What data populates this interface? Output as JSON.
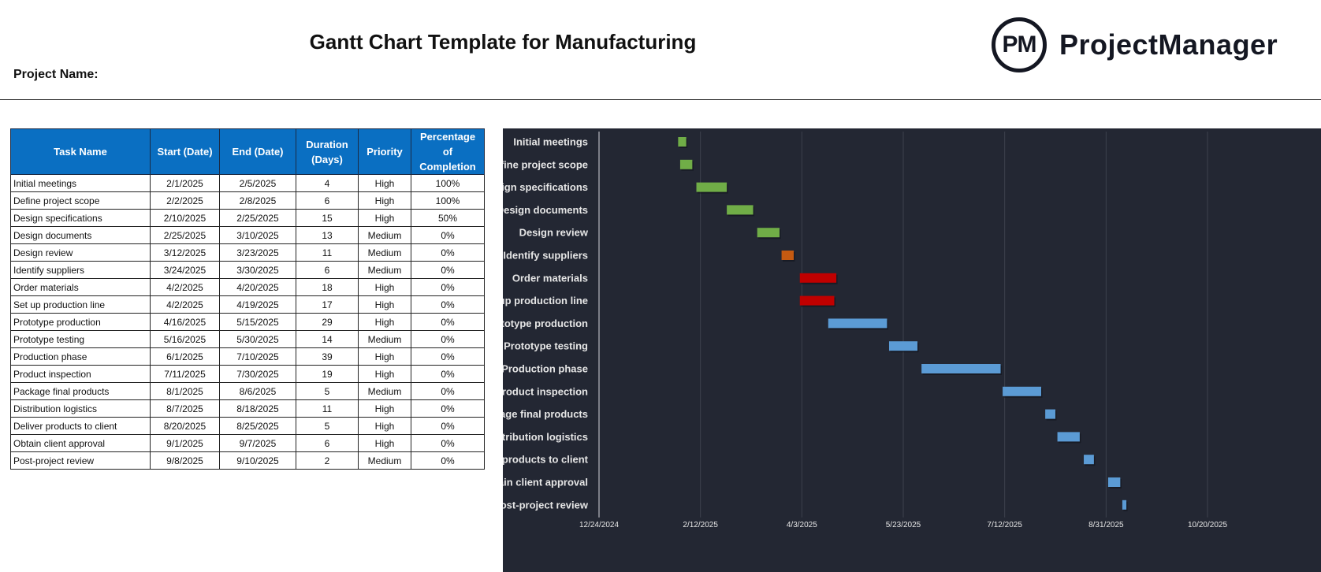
{
  "header": {
    "title": "Gantt Chart Template for Manufacturing",
    "project_name_label": "Project Name:",
    "logo": {
      "mark": "PM",
      "brand": "ProjectManager"
    }
  },
  "table": {
    "columns": [
      "Task Name",
      "Start  (Date)",
      "End  (Date)",
      "Duration (Days)",
      "Priority",
      "Percentage of Completion"
    ],
    "rows": [
      [
        "Initial meetings",
        "2/1/2025",
        "2/5/2025",
        "4",
        "High",
        "100%"
      ],
      [
        "Define project scope",
        "2/2/2025",
        "2/8/2025",
        "6",
        "High",
        "100%"
      ],
      [
        "Design specifications",
        "2/10/2025",
        "2/25/2025",
        "15",
        "High",
        "50%"
      ],
      [
        "Design documents",
        "2/25/2025",
        "3/10/2025",
        "13",
        "Medium",
        "0%"
      ],
      [
        "Design review",
        "3/12/2025",
        "3/23/2025",
        "11",
        "Medium",
        "0%"
      ],
      [
        "Identify suppliers",
        "3/24/2025",
        "3/30/2025",
        "6",
        "Medium",
        "0%"
      ],
      [
        "Order materials",
        "4/2/2025",
        "4/20/2025",
        "18",
        "High",
        "0%"
      ],
      [
        "Set up production line",
        "4/2/2025",
        "4/19/2025",
        "17",
        "High",
        "0%"
      ],
      [
        "Prototype production",
        "4/16/2025",
        "5/15/2025",
        "29",
        "High",
        "0%"
      ],
      [
        "Prototype testing",
        "5/16/2025",
        "5/30/2025",
        "14",
        "Medium",
        "0%"
      ],
      [
        "Production phase",
        "6/1/2025",
        "7/10/2025",
        "39",
        "High",
        "0%"
      ],
      [
        "Product inspection",
        "7/11/2025",
        "7/30/2025",
        "19",
        "High",
        "0%"
      ],
      [
        "Package final products",
        "8/1/2025",
        "8/6/2025",
        "5",
        "Medium",
        "0%"
      ],
      [
        "Distribution logistics",
        "8/7/2025",
        "8/18/2025",
        "11",
        "High",
        "0%"
      ],
      [
        "Deliver products to client",
        "8/20/2025",
        "8/25/2025",
        "5",
        "High",
        "0%"
      ],
      [
        "Obtain client approval",
        "9/1/2025",
        "9/7/2025",
        "6",
        "High",
        "0%"
      ],
      [
        "Post-project review",
        "9/8/2025",
        "9/10/2025",
        "2",
        "Medium",
        "0%"
      ]
    ]
  },
  "chart_data": {
    "type": "bar",
    "orientation": "horizontal-gantt",
    "title": "",
    "xlabel": "",
    "ylabel": "",
    "x_axis": {
      "type": "date",
      "range": [
        "2024-12-24",
        "2025-10-20"
      ],
      "tick_labels": [
        "12/24/2024",
        "2/12/2025",
        "4/3/2025",
        "5/23/2025",
        "7/12/2025",
        "8/31/2025",
        "10/20/2025"
      ],
      "tick_interval_days": 50,
      "grid": true
    },
    "legend": "none",
    "colors": {
      "green": "#70ad47",
      "orange": "#c55a11",
      "red": "#c00000",
      "blue": "#5b9bd5",
      "background": "#232733"
    },
    "tasks": [
      {
        "name": "Initial meetings",
        "start": "2025-02-01",
        "duration": 4,
        "color": "green"
      },
      {
        "name": "Define project scope",
        "start": "2025-02-02",
        "duration": 6,
        "color": "green"
      },
      {
        "name": "Design specifications",
        "start": "2025-02-10",
        "duration": 15,
        "color": "green"
      },
      {
        "name": "Design documents",
        "start": "2025-02-25",
        "duration": 13,
        "color": "green"
      },
      {
        "name": "Design review",
        "start": "2025-03-12",
        "duration": 11,
        "color": "green"
      },
      {
        "name": "Identify suppliers",
        "start": "2025-03-24",
        "duration": 6,
        "color": "orange"
      },
      {
        "name": "Order materials",
        "start": "2025-04-02",
        "duration": 18,
        "color": "red"
      },
      {
        "name": "Set up production line",
        "start": "2025-04-02",
        "duration": 17,
        "color": "red"
      },
      {
        "name": "Prototype production",
        "start": "2025-04-16",
        "duration": 29,
        "color": "blue"
      },
      {
        "name": "Prototype testing",
        "start": "2025-05-16",
        "duration": 14,
        "color": "blue"
      },
      {
        "name": "Production phase",
        "start": "2025-06-01",
        "duration": 39,
        "color": "blue"
      },
      {
        "name": "Product inspection",
        "start": "2025-07-11",
        "duration": 19,
        "color": "blue"
      },
      {
        "name": "Package final products",
        "start": "2025-08-01",
        "duration": 5,
        "color": "blue"
      },
      {
        "name": "Distribution logistics",
        "start": "2025-08-07",
        "duration": 11,
        "color": "blue"
      },
      {
        "name": "Deliver products to client",
        "start": "2025-08-20",
        "duration": 5,
        "color": "blue"
      },
      {
        "name": "Obtain client approval",
        "start": "2025-09-01",
        "duration": 6,
        "color": "blue"
      },
      {
        "name": "Post-project review",
        "start": "2025-09-08",
        "duration": 2,
        "color": "blue"
      }
    ]
  }
}
